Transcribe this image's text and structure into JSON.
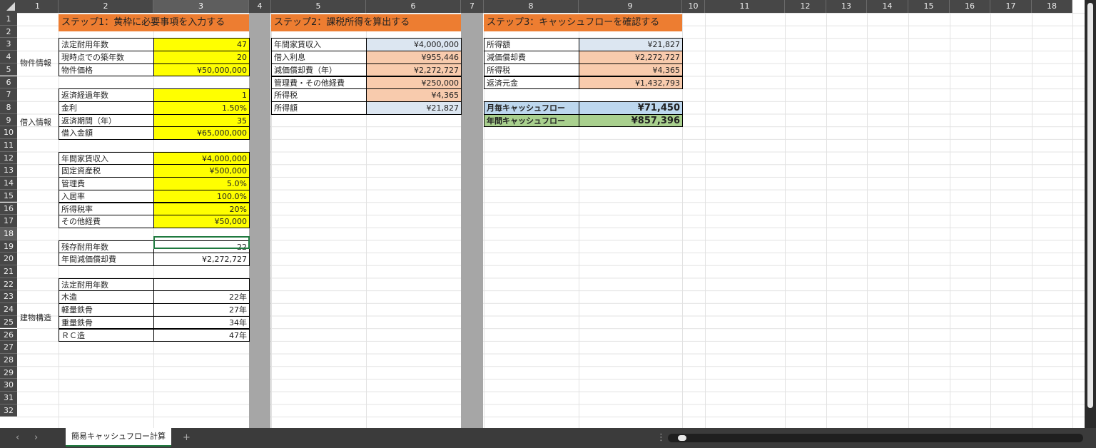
{
  "columns": [
    "1",
    "2",
    "3",
    "4",
    "5",
    "6",
    "7",
    "8",
    "9",
    "10",
    "11",
    "12",
    "13",
    "14",
    "15",
    "16",
    "17",
    "18"
  ],
  "rows": [
    "1",
    "2",
    "3",
    "4",
    "5",
    "6",
    "7",
    "8",
    "9",
    "10",
    "11",
    "12",
    "13",
    "14",
    "15",
    "16",
    "17",
    "18",
    "19",
    "20",
    "21",
    "22",
    "23",
    "24",
    "25",
    "26",
    "27",
    "28",
    "29",
    "30",
    "31",
    "32"
  ],
  "steps": {
    "step1": "ステップ1：黄枠に必要事項を入力する",
    "step2": "ステップ2：課税所得を算出する",
    "step3": "ステップ3：キャッシュフローを確認する"
  },
  "side_labels": {
    "property": "物件情報",
    "loan": "借入情報",
    "structure": "建物構造"
  },
  "property": [
    {
      "label": "法定耐用年数",
      "value": "47"
    },
    {
      "label": "現時点での築年数",
      "value": "20"
    },
    {
      "label": "物件価格",
      "value": "¥50,000,000"
    }
  ],
  "loan": [
    {
      "label": "返済経過年数",
      "value": "1"
    },
    {
      "label": "金利",
      "value": "1.50%"
    },
    {
      "label": "返済期間（年）",
      "value": "35"
    },
    {
      "label": "借入金額",
      "value": "¥65,000,000"
    }
  ],
  "income": [
    {
      "label": "年間家賃収入",
      "value": "¥4,000,000"
    },
    {
      "label": "固定資産税",
      "value": "¥500,000"
    },
    {
      "label": "管理費",
      "value": "5.0%"
    },
    {
      "label": "入居率",
      "value": "100.0%"
    },
    {
      "label": "所得税率",
      "value": "20%"
    },
    {
      "label": "その他経費",
      "value": "¥50,000"
    }
  ],
  "computed": [
    {
      "label": "残存耐用年数",
      "value": "22"
    },
    {
      "label": "年間減価償却費",
      "value": "¥2,272,727"
    }
  ],
  "structure": [
    {
      "label": "法定耐用年数",
      "value": ""
    },
    {
      "label": "木造",
      "value": "22年"
    },
    {
      "label": "軽量鉄骨",
      "value": "27年"
    },
    {
      "label": "重量鉄骨",
      "value": "34年"
    },
    {
      "label": "ＲＣ造",
      "value": "47年"
    }
  ],
  "taxable": [
    {
      "label": "年間家賃収入",
      "value": "¥4,000,000",
      "color": "blue"
    },
    {
      "label": "借入利息",
      "value": "¥955,446",
      "color": "pink"
    },
    {
      "label": "減価償却費（年）",
      "value": "¥2,272,727",
      "color": "pink"
    },
    {
      "label": "管理費・その他経費",
      "value": "¥250,000",
      "color": "pink"
    },
    {
      "label": "所得税",
      "value": "¥4,365",
      "color": "pink"
    },
    {
      "label": "所得額",
      "value": "¥21,827",
      "color": "blue"
    }
  ],
  "cashflow": [
    {
      "label": "所得額",
      "value": "¥21,827",
      "color": "blue"
    },
    {
      "label": "減価償却費",
      "value": "¥2,272,727",
      "color": "pink"
    },
    {
      "label": "所得税",
      "value": "¥4,365",
      "color": "pink"
    },
    {
      "label": "返済元金",
      "value": "¥1,432,793",
      "color": "pink"
    }
  ],
  "summary": {
    "monthly_label": "月毎キャッシュフロー",
    "monthly_value": "¥71,450",
    "annual_label": "年間キャッシュフロー",
    "annual_value": "¥857,396"
  },
  "sheet_tab": "簡易キャッシュフロー計算",
  "nav": {
    "prev": "‹",
    "next": "›",
    "add": "+",
    "more": "⋮"
  },
  "colors": {
    "header_orange": "#ed7d31",
    "input_yellow": "#ffff00",
    "blue": "#dce6f1",
    "pink": "#f8cbad",
    "monthly": "#bdd7ee",
    "annual": "#a9d08e"
  }
}
